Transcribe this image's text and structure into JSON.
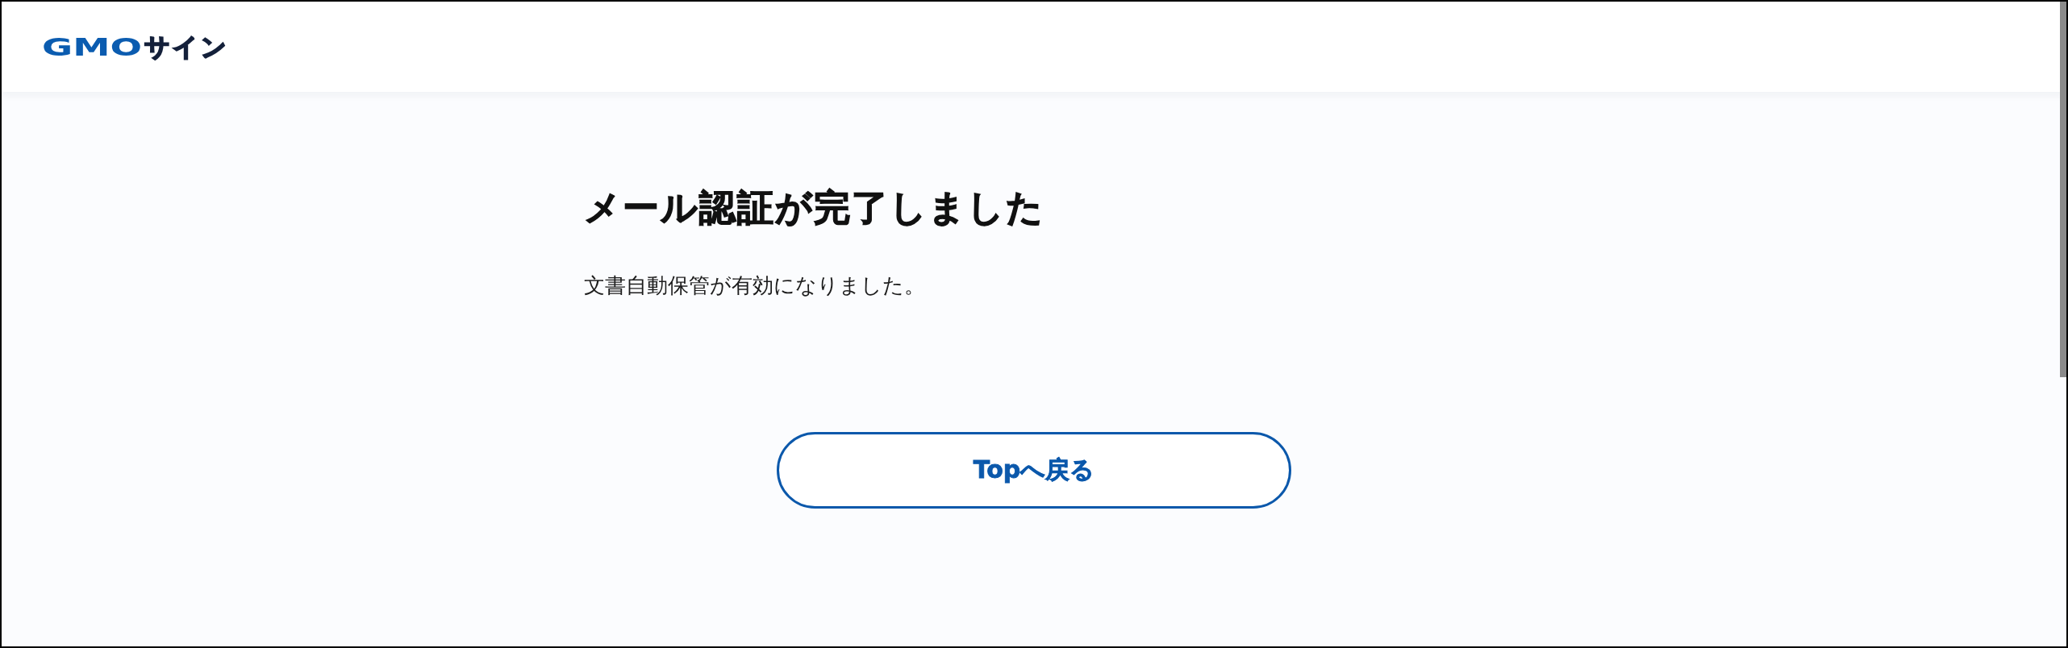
{
  "header": {
    "logo": {
      "brand": "GMO",
      "product": "サイン"
    }
  },
  "main": {
    "title": "メール認証が完了しました",
    "message": "文書自動保管が有効になりました。",
    "button": {
      "label": "Topへ戻る"
    }
  }
}
